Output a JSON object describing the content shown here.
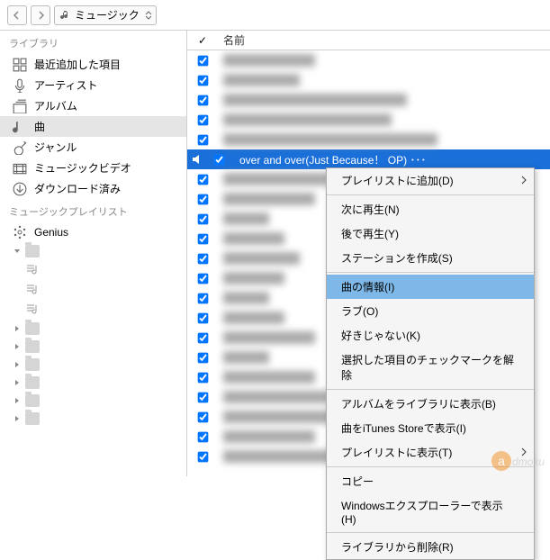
{
  "toolbar": {
    "dropdown_label": "ミュージック"
  },
  "sidebar": {
    "library_header": "ライブラリ",
    "library": [
      {
        "label": "最近追加した項目",
        "icon": "grid"
      },
      {
        "label": "アーティスト",
        "icon": "mic"
      },
      {
        "label": "アルバム",
        "icon": "album"
      },
      {
        "label": "曲",
        "icon": "note",
        "selected": true
      },
      {
        "label": "ジャンル",
        "icon": "guitar"
      },
      {
        "label": "ミュージックビデオ",
        "icon": "video"
      },
      {
        "label": "ダウンロード済み",
        "icon": "download"
      }
    ],
    "playlist_header": "ミュージックプレイリスト",
    "genius_label": "Genius"
  },
  "list": {
    "header_check": "✓",
    "header_name": "名前",
    "rows": [
      {
        "checked": true,
        "text": "████████████",
        "blur": true
      },
      {
        "checked": true,
        "text": "██████████",
        "blur": true
      },
      {
        "checked": true,
        "text": "████████████████████████",
        "blur": true
      },
      {
        "checked": true,
        "text": "██████████████████████",
        "blur": true
      },
      {
        "checked": true,
        "text": "████████████████████████████",
        "blur": true
      },
      {
        "checked": true,
        "text": "over and over(Just Because！ OP) ･･･",
        "selected": true,
        "speaker": true
      },
      {
        "checked": true,
        "text": "██████████████",
        "blur": true
      },
      {
        "checked": true,
        "text": "████████████",
        "blur": true
      },
      {
        "checked": true,
        "text": "██████",
        "blur": true
      },
      {
        "checked": true,
        "text": "████████",
        "blur": true
      },
      {
        "checked": true,
        "text": "██████████",
        "blur": true
      },
      {
        "checked": true,
        "text": "████████",
        "blur": true
      },
      {
        "checked": true,
        "text": "██████",
        "blur": true
      },
      {
        "checked": true,
        "text": "████████",
        "blur": true
      },
      {
        "checked": true,
        "text": "████████████",
        "blur": true
      },
      {
        "checked": true,
        "text": "██████",
        "blur": true
      },
      {
        "checked": true,
        "text": "████████████",
        "blur": true
      },
      {
        "checked": true,
        "text": "██████████████",
        "blur": true
      },
      {
        "checked": true,
        "text": "███████████████████████",
        "blur": true
      },
      {
        "checked": true,
        "text": "████████████",
        "blur": true
      },
      {
        "checked": true,
        "text": "████████████████████████",
        "blur": true
      }
    ]
  },
  "context_menu": {
    "items": [
      {
        "label": "プレイリストに追加(D)",
        "submenu": true
      },
      {
        "sep": true
      },
      {
        "label": "次に再生(N)"
      },
      {
        "label": "後で再生(Y)"
      },
      {
        "label": "ステーションを作成(S)"
      },
      {
        "sep": true
      },
      {
        "label": "曲の情報(I)",
        "highlighted": true
      },
      {
        "label": "ラブ(O)"
      },
      {
        "label": "好きじゃない(K)"
      },
      {
        "label": "選択した項目のチェックマークを解除"
      },
      {
        "sep": true
      },
      {
        "label": "アルバムをライブラリに表示(B)"
      },
      {
        "label": "曲をiTunes Storeで表示(I)"
      },
      {
        "label": "プレイリストに表示(T)",
        "submenu": true
      },
      {
        "sep": true
      },
      {
        "label": "コピー"
      },
      {
        "label": "Windowsエクスプローラーで表示(H)"
      },
      {
        "sep": true
      },
      {
        "label": "ライブラリから削除(R)"
      }
    ]
  },
  "watermark": {
    "text": "dmoku"
  }
}
